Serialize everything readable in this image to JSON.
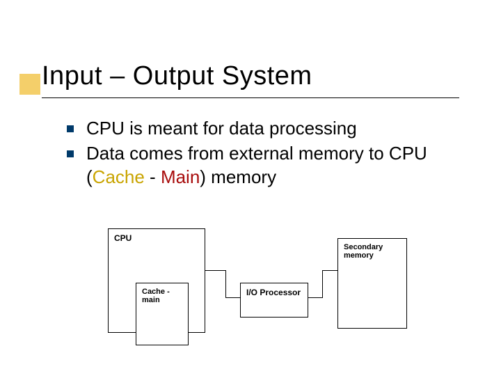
{
  "title": "Input – Output System",
  "bullets": [
    "CPU is meant for data processing",
    "Data comes from external memory to CPU (<span class=\"c-cache\">Cache</span> - <span class=\"c-main\">Main</span>) memory"
  ],
  "diagram": {
    "cpu": "CPU",
    "cache": "Cache - main",
    "io": "I/O Processor",
    "memory": "Secondary memory"
  }
}
